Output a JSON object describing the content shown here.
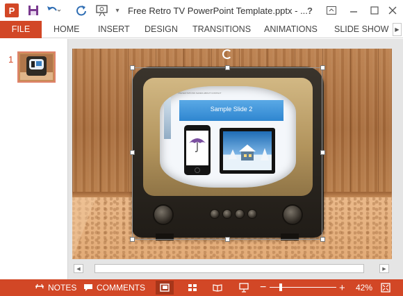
{
  "window": {
    "title": "Free Retro TV PowerPoint Template.pptx - ...",
    "app_logo_letter": "P",
    "help_label": "?"
  },
  "ribbon": {
    "tabs": [
      {
        "label": "FILE",
        "active": true
      },
      {
        "label": "HOME"
      },
      {
        "label": "INSERT"
      },
      {
        "label": "DESIGN"
      },
      {
        "label": "TRANSITIONS"
      },
      {
        "label": "ANIMATIONS"
      },
      {
        "label": "SLIDE SHOW"
      }
    ]
  },
  "thumbnails": {
    "items": [
      {
        "number": "1",
        "selected": true
      }
    ]
  },
  "slide": {
    "inner_title": "Sample Slide 2",
    "inner_menu": "PRESENTATIONS   SLIDES   ABOUT   CONTACT"
  },
  "statusbar": {
    "notes_label": "NOTES",
    "comments_label": "COMMENTS",
    "zoom_value": "42%",
    "zoom_fraction": 0.42
  },
  "colors": {
    "accent": "#d24726",
    "status_active": "#a7361a"
  },
  "icons": [
    "app-logo-icon",
    "save-icon",
    "undo-icon",
    "redo-icon",
    "present-from-start-icon",
    "customize-qat-icon",
    "help-icon",
    "ribbon-display-icon",
    "minimize-icon",
    "maximize-icon",
    "close-icon",
    "notes-icon",
    "comments-icon",
    "normal-view-icon",
    "slide-sorter-icon",
    "reading-view-icon",
    "slide-show-icon",
    "fit-to-window-icon"
  ]
}
